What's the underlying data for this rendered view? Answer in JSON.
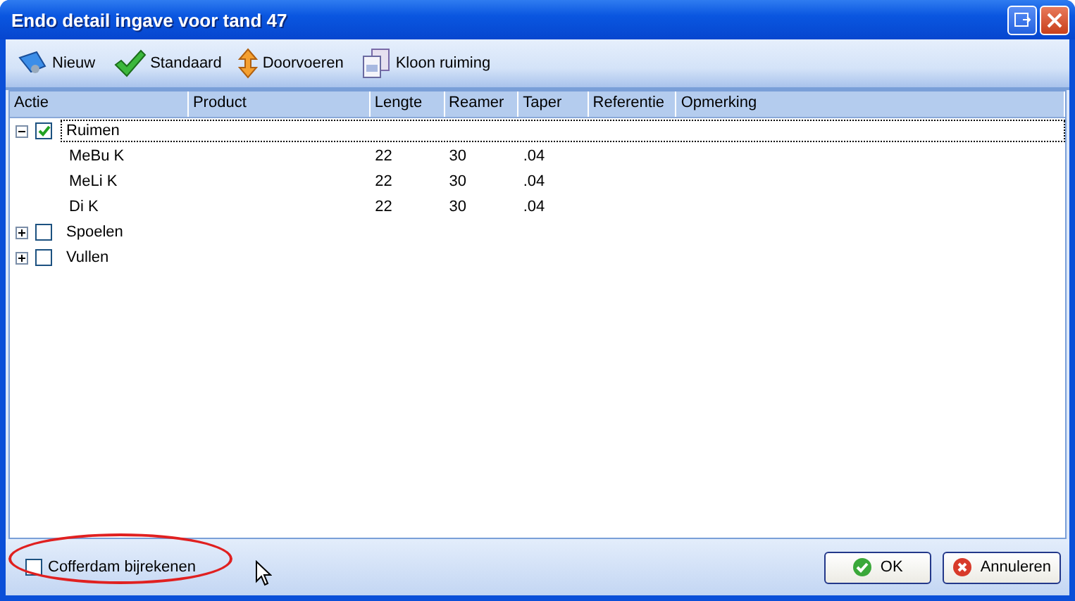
{
  "window": {
    "title": "Endo detail ingave voor tand 47"
  },
  "toolbar": [
    {
      "kind": "new",
      "label": "Nieuw"
    },
    {
      "kind": "default",
      "label": "Standaard"
    },
    {
      "kind": "transfer",
      "label": "Doorvoeren"
    },
    {
      "kind": "clone",
      "label": "Kloon ruiming"
    }
  ],
  "table": {
    "columns": [
      "Actie",
      "Product",
      "Lengte",
      "Reamer",
      "Taper",
      "Referentie",
      "Opmerking"
    ],
    "rows": [
      {
        "label": "Ruimen",
        "checked": true,
        "expanded": true,
        "selected": true,
        "children": [
          {
            "cells": [
              "MeBu K",
              "",
              "22",
              "30",
              ".04",
              "",
              ""
            ]
          },
          {
            "cells": [
              "MeLi K",
              "",
              "22",
              "30",
              ".04",
              "",
              ""
            ]
          },
          {
            "cells": [
              "Di K",
              "",
              "22",
              "30",
              ".04",
              "",
              ""
            ]
          }
        ]
      },
      {
        "label": "Spoelen",
        "checked": false,
        "expanded": false,
        "selected": false
      },
      {
        "label": "Vullen",
        "checked": false,
        "expanded": false,
        "selected": false
      }
    ]
  },
  "footer": {
    "checkbox": {
      "label": "Cofferdam bijrekenen",
      "checked": false,
      "highlighted": true
    },
    "buttons": [
      {
        "kind": "ok",
        "label": "OK"
      },
      {
        "kind": "cancel",
        "label": "Annuleren"
      }
    ]
  }
}
